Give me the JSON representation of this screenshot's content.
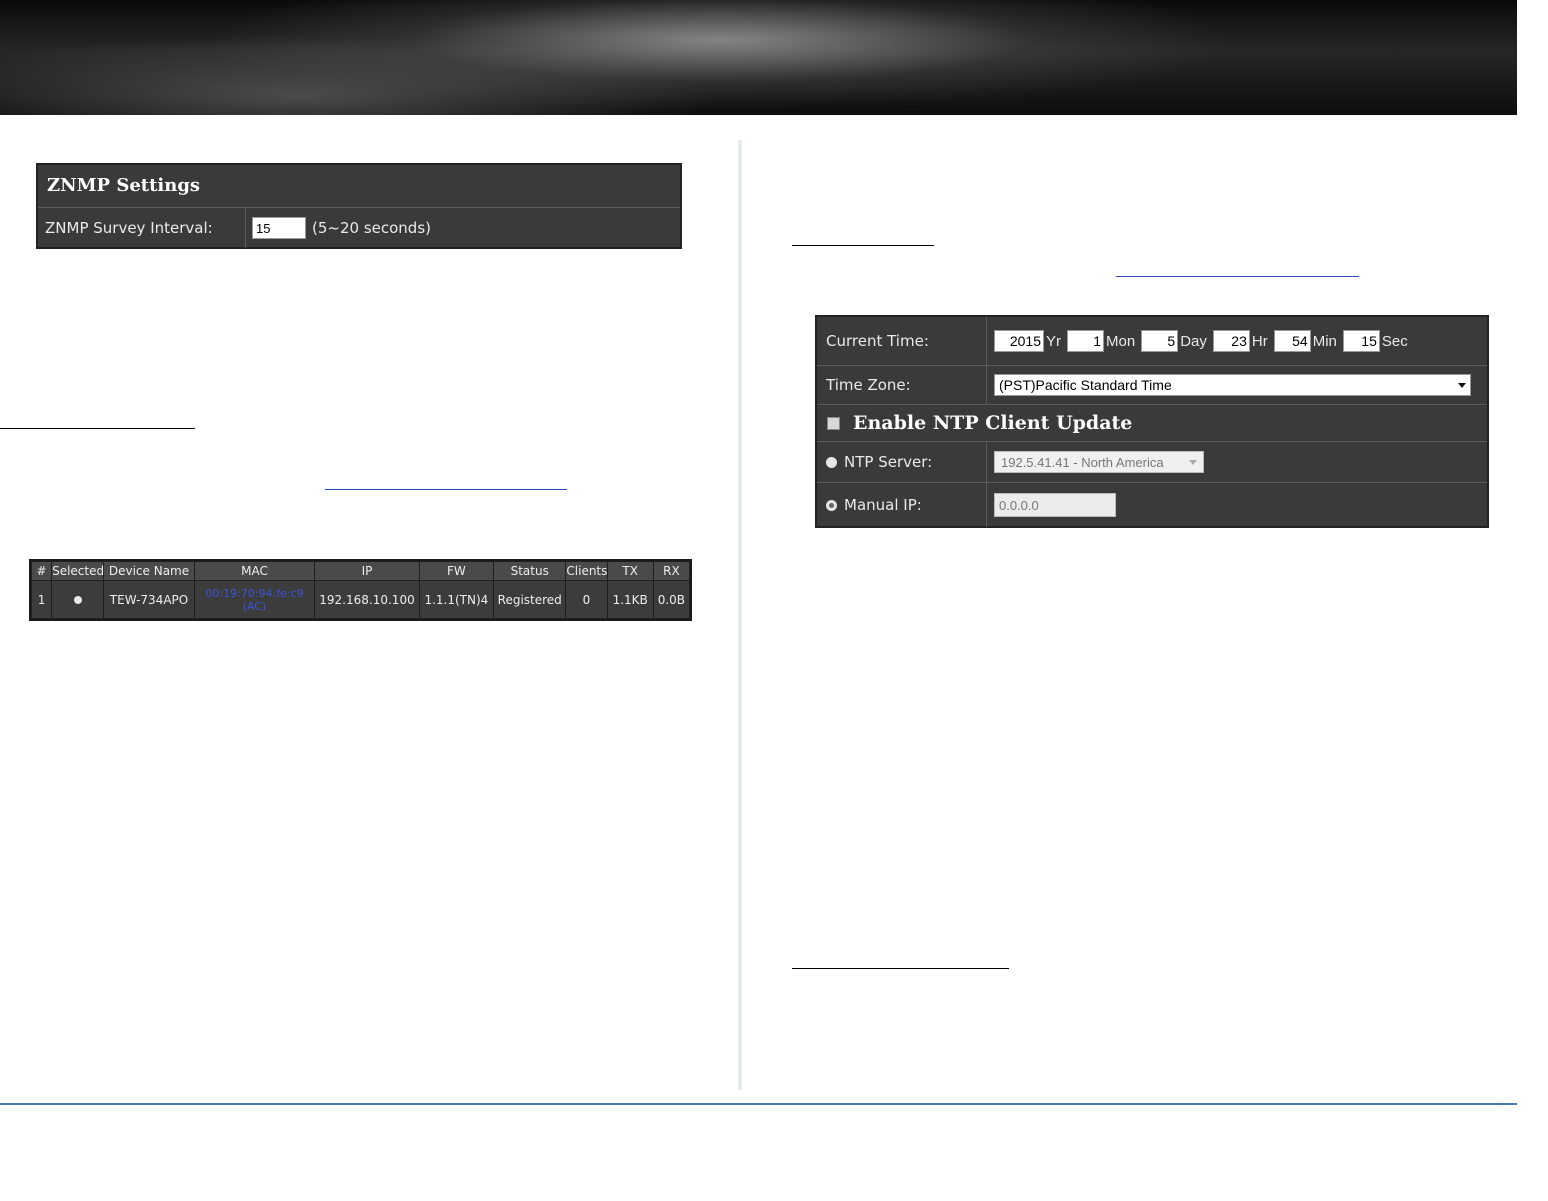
{
  "znmp": {
    "title": "ZNMP Settings",
    "interval_label": "ZNMP Survey Interval:",
    "interval_value": "15",
    "interval_hint": "(5~20 seconds)"
  },
  "device_table": {
    "headers": [
      "#",
      "Selected",
      "Device Name",
      "MAC",
      "IP",
      "FW",
      "Status",
      "Clients",
      "TX",
      "RX"
    ],
    "rows": [
      {
        "num": "1",
        "device_name": "TEW-734APO",
        "mac": "00:19:70:94:fe:c9",
        "mac_note": "(AC)",
        "ip": "192.168.10.100",
        "fw": "1.1.1(TN)4",
        "status": "Registered",
        "clients": "0",
        "tx": "1.1KB",
        "rx": "0.0B"
      }
    ]
  },
  "time_settings": {
    "current_time_label": "Current Time:",
    "year": "2015",
    "year_unit": "Yr",
    "month": "1",
    "month_unit": "Mon",
    "day": "5",
    "day_unit": "Day",
    "hour": "23",
    "hour_unit": "Hr",
    "minute": "54",
    "minute_unit": "Min",
    "second": "15",
    "second_unit": "Sec",
    "timezone_label": "Time Zone:",
    "timezone_value": "(PST)Pacific Standard Time",
    "ntp_enable_label": "Enable NTP Client Update",
    "ntp_server_label": "NTP Server:",
    "ntp_server_value": "192.5.41.41 - North America",
    "manual_ip_label": "Manual IP:",
    "manual_ip_value": "0.0.0.0"
  },
  "colors": {
    "panel_bg": "#3a3a3a",
    "footer_rule": "#4a7bb0",
    "mac_link": "#3a55d6"
  }
}
